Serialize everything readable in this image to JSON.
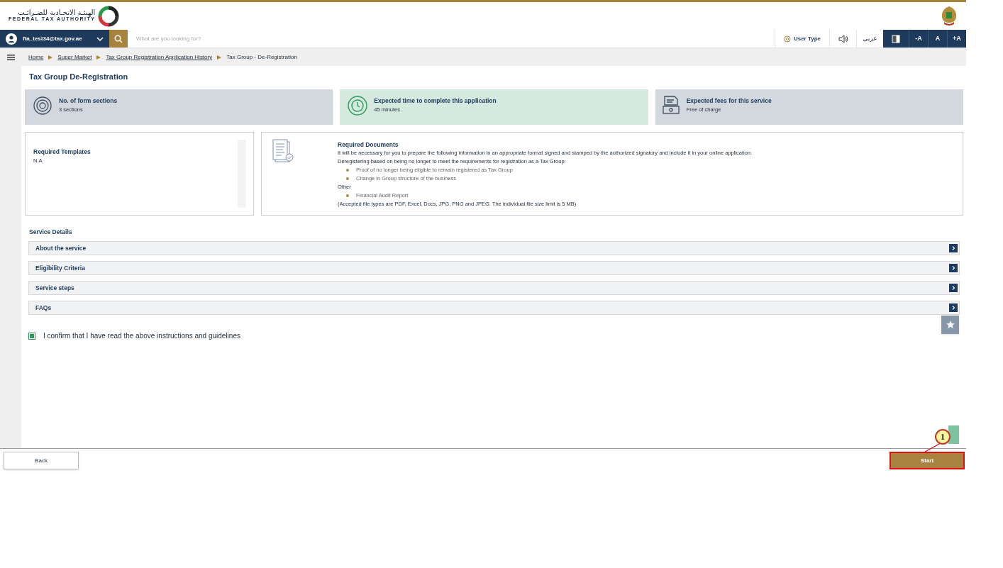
{
  "header": {
    "logo_arabic": "الهيئـة الاتحـادية للضـرائـب",
    "logo_english": "FEDERAL TAX AUTHORITY"
  },
  "nav": {
    "user": "fta_test34@tax.gov.ae",
    "search_placeholder": "What are you looking for?",
    "user_type": "User Type",
    "language": "عربي",
    "font_buttons": [
      "-A",
      "A",
      "+A"
    ]
  },
  "breadcrumb": [
    {
      "label": "Home",
      "link": true
    },
    {
      "label": "Super Market",
      "link": true
    },
    {
      "label": "Tax Group Registration Application History",
      "link": true
    },
    {
      "label": "Tax Group - De-Registration",
      "link": false
    }
  ],
  "page_title": "Tax Group De-Registration",
  "info_cards": [
    {
      "kind": "sections",
      "title": "No. of form sections",
      "value": "3 sections",
      "highlighted": false
    },
    {
      "kind": "time",
      "title": "Expected time to complete this application",
      "value": "45 minutes",
      "highlighted": true
    },
    {
      "kind": "fees",
      "title": "Expected fees for this service",
      "value": "Free of charge",
      "highlighted": false
    }
  ],
  "templates": {
    "title": "Required Templates",
    "value": "N.A"
  },
  "documents": {
    "title": "Required Documents",
    "intro": "It will be necessary for you to prepare the following information in an appropriate format signed and stamped by the authorized signatory and include it in your online application:",
    "groups": [
      {
        "heading": "Deregistering based on being no longer to meet the requirements for registration as a Tax Group:",
        "items": [
          "Proof of no longer being eligible to remain registered as Tax Group",
          "Change in Group structure of the business"
        ]
      },
      {
        "heading": "Other",
        "items": [
          "Financial Audit Report"
        ]
      }
    ],
    "note": "(Accepted file types are PDF, Excel, Docs, JPG, PNG and JPEG. The individual file size limit is 5 MB)"
  },
  "service_details": {
    "title": "Service Details",
    "sections": [
      "About the service",
      "Eligibility Criteria",
      "Service steps",
      "FAQs"
    ]
  },
  "confirm": {
    "label": "I confirm that I have read the above instructions and guidelines",
    "checked": true
  },
  "footer": {
    "back": "Back",
    "start": "Start"
  },
  "annotation": {
    "number": "1"
  }
}
